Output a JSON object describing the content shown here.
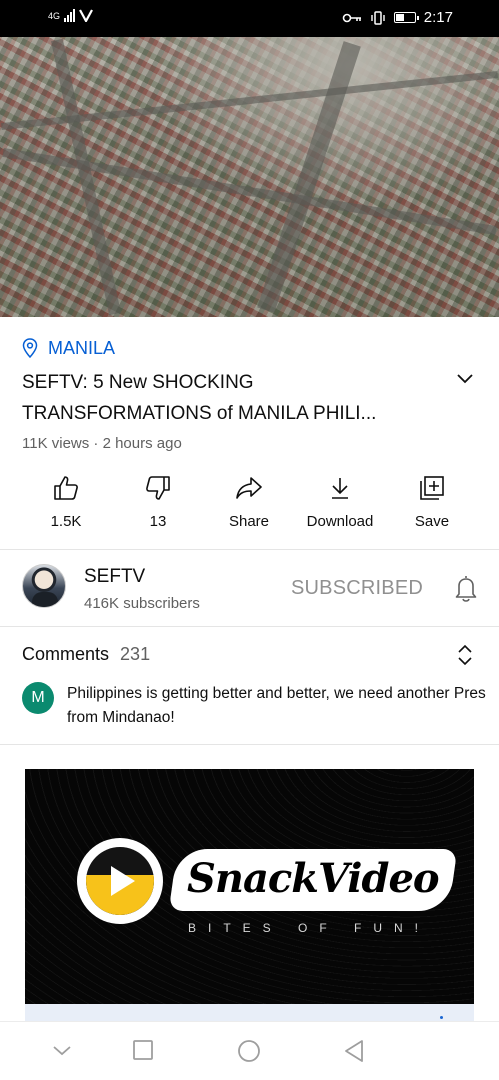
{
  "status_bar": {
    "network": "4G",
    "time": "2:17",
    "battery_percent": 40
  },
  "video": {
    "thumbnail_icon": "aerial-city-view",
    "location": "MANILA",
    "title_line1": "SEFTV: 5 New SHOCKING",
    "title_line2": "TRANSFORMATIONS of MANILA PHILI...",
    "views_time": "11K views · 2 hours ago"
  },
  "actions": {
    "like_count": "1.5K",
    "dislike_count": "13",
    "share_label": "Share",
    "download_label": "Download",
    "save_label": "Save"
  },
  "channel": {
    "name": "SEFTV",
    "subscribers": "416K subscribers",
    "subscribe_state": "SUBSCRIBED"
  },
  "comments": {
    "label": "Comments",
    "count": "231",
    "top_comment_avatar": "M",
    "top_comment_text": "Philippines is getting better and better, we need another Pres from Mindanao!"
  },
  "ad": {
    "brand": "SnackVideo",
    "tagline": "BITES OF FUN!"
  },
  "colors": {
    "link_blue": "#065fd4",
    "secondary_text": "#606060",
    "comment_avatar": "#0b8a6f",
    "brand_yellow": "#f7c21a"
  }
}
